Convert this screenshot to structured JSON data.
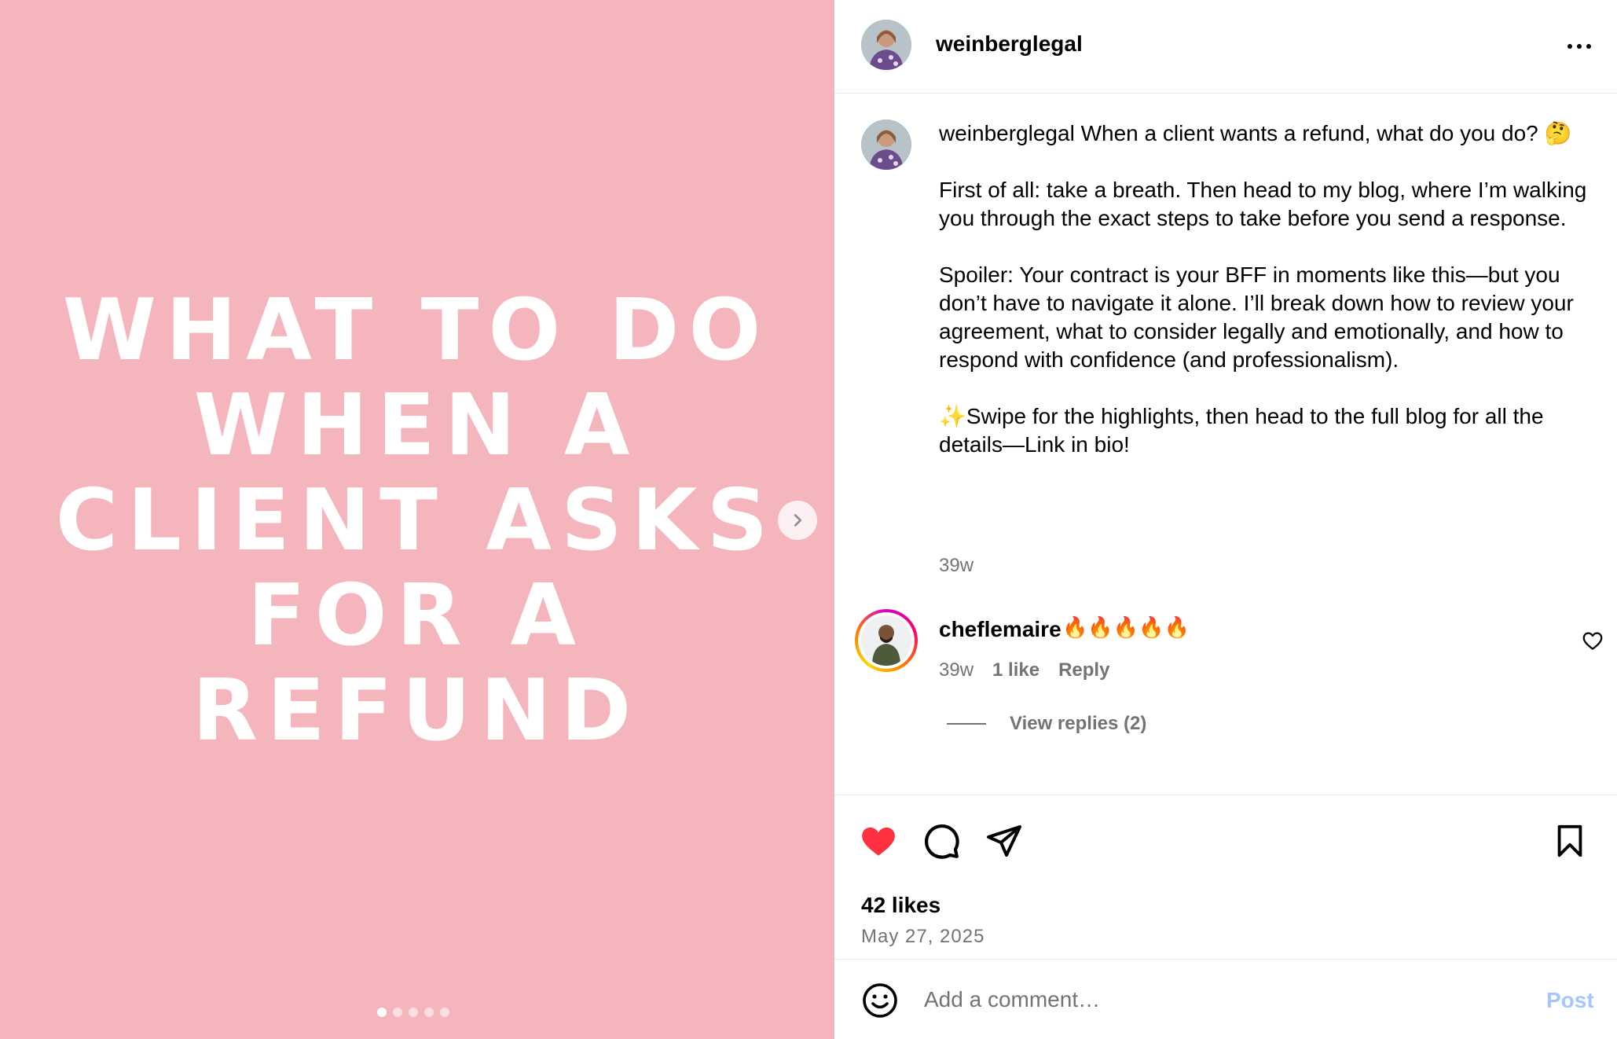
{
  "media": {
    "title_lines": [
      "WHAT TO DO",
      "WHEN A",
      "CLIENT ASKS",
      "FOR A",
      "REFUND"
    ],
    "background": "#f4b5bd",
    "slide_count": 5,
    "active_slide": 1
  },
  "header": {
    "username": "weinberglegal"
  },
  "caption": {
    "username": "weinberglegal",
    "line1": "When a client wants a refund, what do you do? 🤔",
    "para1": "First of all: take a breath. Then head to my blog, where I’m walking you through the exact steps to take before you send a response.",
    "para2": "Spoiler: Your contract is your BFF in moments like this—but you don’t have to navigate it alone. I’ll break down how to review your agreement, what to consider legally and emotionally, and how to respond with confidence (and professionalism).",
    "para3": "✨Swipe for the highlights, then head to the full blog for all the details—Link in bio!",
    "time": "39w"
  },
  "comment": {
    "username": "cheflemaire",
    "text": "🔥🔥🔥🔥🔥",
    "time": "39w",
    "likes": "1 like",
    "reply_label": "Reply",
    "view_replies": "View replies (2)"
  },
  "actions": {
    "liked": true,
    "like_color": "#ff3040",
    "likes_text": "42 likes",
    "date": "May 27, 2025"
  },
  "add_comment": {
    "placeholder": "Add a comment…",
    "post_label": "Post",
    "post_color": "#a6c6fb"
  }
}
